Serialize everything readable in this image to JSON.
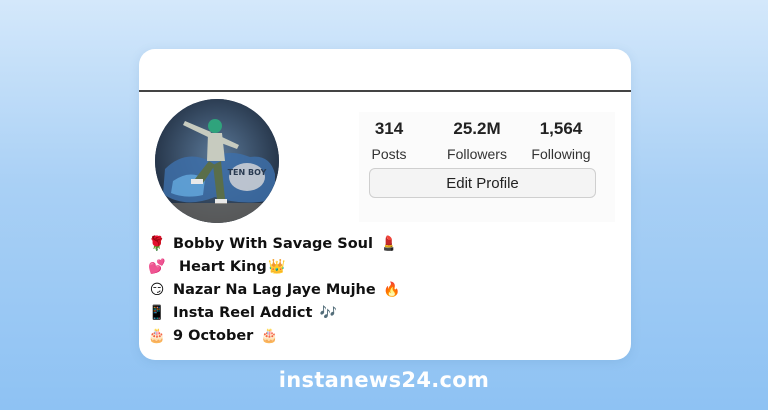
{
  "profile": {
    "stats": [
      {
        "value": "314",
        "label": "Posts"
      },
      {
        "value": "25.2M",
        "label": "Followers"
      },
      {
        "value": "1,564",
        "label": "Following"
      }
    ],
    "edit_profile_label": "Edit Profile",
    "avatar_text": "TEN BOY",
    "bio": [
      {
        "emoji_start": "🌹",
        "text": "Bobby With Savage Soul",
        "emoji_end": "💄"
      },
      {
        "emoji_start": "💕",
        "text": "Heart King",
        "emoji_end": "👑"
      },
      {
        "emoji_start": "😏",
        "text": "Nazar Na Lag Jaye Mujhe",
        "emoji_end": "🔥"
      },
      {
        "emoji_start": "📱",
        "text": "Insta Reel Addict",
        "emoji_end": "🎶"
      },
      {
        "emoji_start": "🎂",
        "text": "9 October",
        "emoji_end": "🎂"
      }
    ]
  },
  "footer": {
    "site": "instanews24.com"
  },
  "colors": {
    "background": "#a9d0f5",
    "card": "#ffffff",
    "footer_text": "#ffffff"
  }
}
